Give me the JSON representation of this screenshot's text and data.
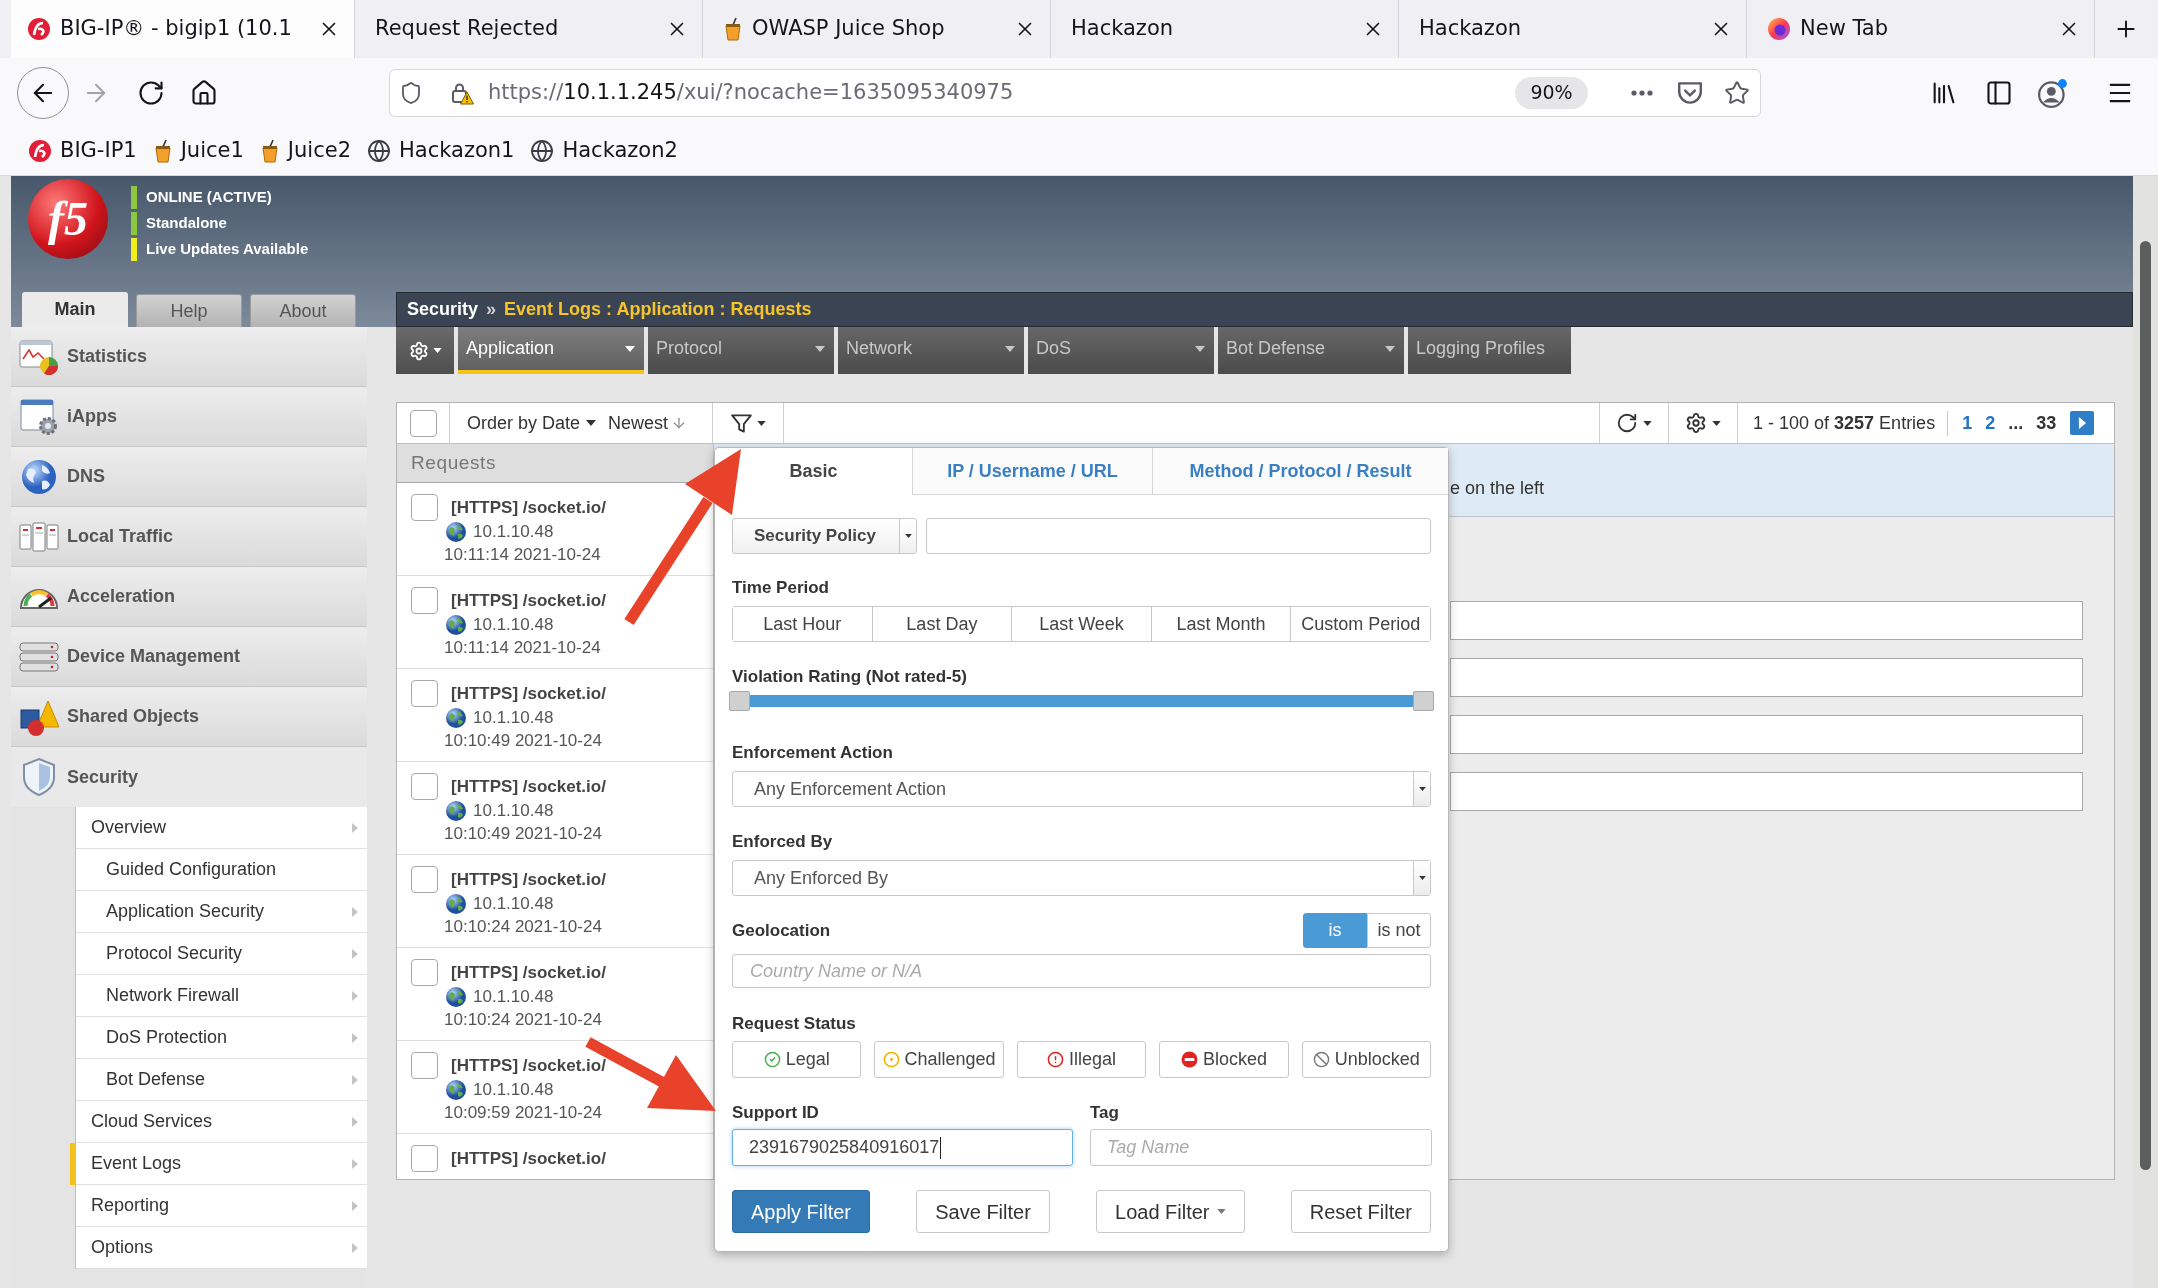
{
  "browser": {
    "tabs": [
      {
        "title": "BIG-IP® - bigip1 (10.1",
        "selected": true
      },
      {
        "title": "Request Rejected",
        "selected": false
      },
      {
        "title": "OWASP Juice Shop",
        "selected": false
      },
      {
        "title": "Hackazon",
        "selected": false
      },
      {
        "title": "Hackazon",
        "selected": false
      },
      {
        "title": "New Tab",
        "selected": false
      }
    ],
    "url": {
      "scheme": "https://",
      "host": "10.1.1.245",
      "path": "/xui/?nocache=1635095340975"
    },
    "zoom": "90%",
    "bookmarks": [
      {
        "label": "BIG-IP1"
      },
      {
        "label": "Juice1"
      },
      {
        "label": "Juice2"
      },
      {
        "label": "Hackazon1"
      },
      {
        "label": "Hackazon2"
      }
    ]
  },
  "header": {
    "logo": "f5",
    "status": [
      {
        "label": "ONLINE (ACTIVE)",
        "color": "#8dc63f"
      },
      {
        "label": "Standalone",
        "color": "#8dc63f"
      },
      {
        "label": "Live Updates Available",
        "color": "#f4ee1c"
      }
    ],
    "tabs": [
      {
        "label": "Main",
        "selected": true
      },
      {
        "label": "Help",
        "selected": false
      },
      {
        "label": "About",
        "selected": false
      }
    ],
    "breadcrumb": {
      "root": "Security",
      "separator": "»",
      "path": "Event Logs : Application : Requests"
    }
  },
  "sidebar": {
    "items": [
      {
        "label": "Statistics",
        "expanded": false
      },
      {
        "label": "iApps",
        "expanded": false
      },
      {
        "label": "DNS",
        "expanded": false
      },
      {
        "label": "Local Traffic",
        "expanded": false
      },
      {
        "label": "Acceleration",
        "expanded": false
      },
      {
        "label": "Device Management",
        "expanded": false
      },
      {
        "label": "Shared Objects",
        "expanded": false
      },
      {
        "label": "Security",
        "expanded": true,
        "children": [
          {
            "label": "Overview",
            "has_submenu": true,
            "selected": false,
            "children": [
              {
                "label": "Guided Configuration",
                "has_submenu": false,
                "selected": false
              },
              {
                "label": "Application Security",
                "has_submenu": true,
                "selected": false
              },
              {
                "label": "Protocol Security",
                "has_submenu": true,
                "selected": false
              },
              {
                "label": "Network Firewall",
                "has_submenu": true,
                "selected": false
              },
              {
                "label": "DoS Protection",
                "has_submenu": true,
                "selected": false
              },
              {
                "label": "Bot Defense",
                "has_submenu": true,
                "selected": false
              }
            ]
          },
          {
            "label": "Cloud Services",
            "has_submenu": true,
            "selected": false
          },
          {
            "label": "Event Logs",
            "has_submenu": true,
            "selected": true
          },
          {
            "label": "Reporting",
            "has_submenu": true,
            "selected": false
          },
          {
            "label": "Options",
            "has_submenu": true,
            "selected": false
          }
        ]
      }
    ]
  },
  "menu": {
    "items": [
      {
        "label": "Application",
        "selected": true,
        "dropdown": true
      },
      {
        "label": "Protocol",
        "selected": false,
        "dropdown": true
      },
      {
        "label": "Network",
        "selected": false,
        "dropdown": true
      },
      {
        "label": "DoS",
        "selected": false,
        "dropdown": true
      },
      {
        "label": "Bot Defense",
        "selected": false,
        "dropdown": true
      },
      {
        "label": "Logging Profiles",
        "selected": false,
        "dropdown": false
      }
    ]
  },
  "toolbar": {
    "select_all": {
      "checked": false
    },
    "order_by": "Order by Date",
    "sort": "Newest",
    "entries": "1 - 100 of **3257** Entries",
    "pages": [
      {
        "label": "1",
        "link": true
      },
      {
        "label": "2",
        "link": true
      },
      {
        "label": "...",
        "link": false
      },
      {
        "label": "33",
        "link": false
      }
    ]
  },
  "requests": {
    "title": "Requests",
    "rows": [
      {
        "title": "[HTTPS] /socket.io/",
        "ip": "10.1.10.48",
        "time": "10:11:14 2021-10-24",
        "checked": false
      },
      {
        "title": "[HTTPS] /socket.io/",
        "ip": "10.1.10.48",
        "time": "10:11:14 2021-10-24",
        "checked": false
      },
      {
        "title": "[HTTPS] /socket.io/",
        "ip": "10.1.10.48",
        "time": "10:10:49 2021-10-24",
        "checked": false
      },
      {
        "title": "[HTTPS] /socket.io/",
        "ip": "10.1.10.48",
        "time": "10:10:49 2021-10-24",
        "checked": false
      },
      {
        "title": "[HTTPS] /socket.io/",
        "ip": "10.1.10.48",
        "time": "10:10:24 2021-10-24",
        "checked": false
      },
      {
        "title": "[HTTPS] /socket.io/",
        "ip": "10.1.10.48",
        "time": "10:10:24 2021-10-24",
        "checked": false
      },
      {
        "title": "[HTTPS] /socket.io/",
        "ip": "10.1.10.48",
        "time": "10:09:59 2021-10-24",
        "checked": false
      },
      {
        "title": "[HTTPS] /socket.io/",
        "checked": false
      }
    ]
  },
  "details": {
    "hint": "e on the left"
  },
  "filter": {
    "tabs": [
      {
        "label": "Basic",
        "selected": true
      },
      {
        "label": "IP / Username / URL",
        "selected": false
      },
      {
        "label": "Method / Protocol / Result",
        "selected": false
      }
    ],
    "security_policy": {
      "label": "Security Policy"
    },
    "time_period": {
      "label": "Time Period",
      "options": [
        {
          "label": "Last Hour",
          "selected": false
        },
        {
          "label": "Last Day",
          "selected": false
        },
        {
          "label": "Last Week",
          "selected": false
        },
        {
          "label": "Last Month",
          "selected": false
        },
        {
          "label": "Custom Period",
          "selected": false
        }
      ]
    },
    "violation_rating": {
      "label": "Violation Rating (Not rated-5)",
      "handles": [
        {
          "level": 0
        },
        {
          "level": 1
        }
      ]
    },
    "enforcement_action": {
      "label": "Enforcement Action",
      "value": "Any Enforcement Action"
    },
    "enforced_by": {
      "label": "Enforced By",
      "value": "Any Enforced By"
    },
    "geolocation": {
      "label": "Geolocation",
      "operators": [
        {
          "label": "is",
          "selected": true
        },
        {
          "label": "is not",
          "selected": false
        }
      ],
      "placeholder": "Country Name or N/A"
    },
    "request_status": {
      "label": "Request Status",
      "options": [
        {
          "label": "Legal",
          "selected": false
        },
        {
          "label": "Challenged",
          "selected": false
        },
        {
          "label": "Illegal",
          "selected": false
        },
        {
          "label": "Blocked",
          "selected": false
        },
        {
          "label": "Unblocked",
          "selected": false
        }
      ]
    },
    "support_id": {
      "label": "Support ID",
      "value": "2391679025840916017",
      "focused": true
    },
    "tag": {
      "label": "Tag",
      "placeholder": "Tag Name"
    },
    "buttons": [
      {
        "label": "Apply Filter",
        "kind": "primary"
      },
      {
        "label": "Save Filter",
        "kind": "default"
      },
      {
        "label": "Load Filter",
        "kind": "dropdown"
      },
      {
        "label": "Reset Filter",
        "kind": "default"
      }
    ]
  }
}
